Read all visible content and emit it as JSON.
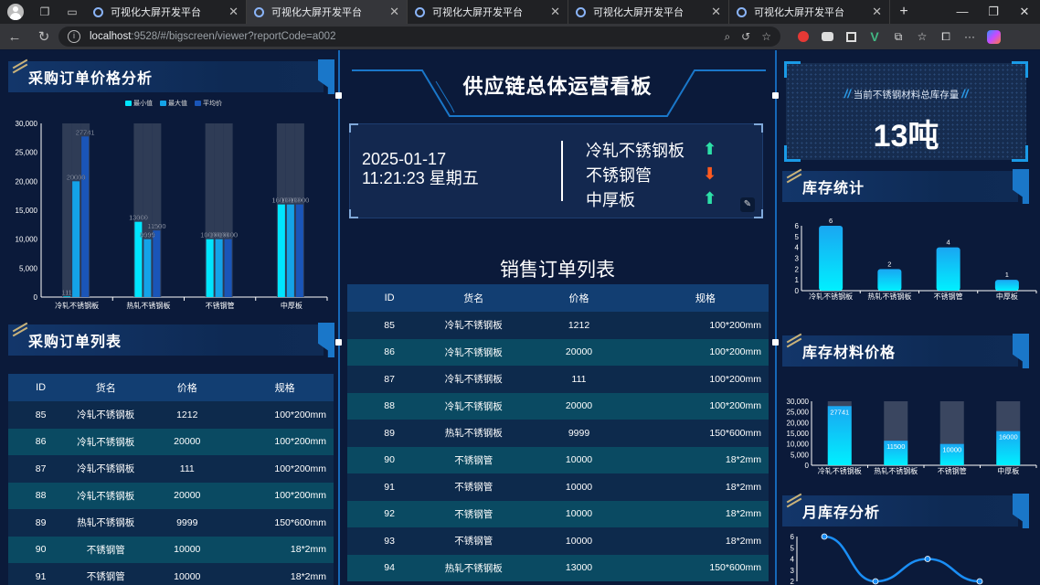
{
  "browser": {
    "tabs": [
      {
        "title": "可视化大屏开发平台",
        "active": false
      },
      {
        "title": "可视化大屏开发平台",
        "active": true
      },
      {
        "title": "可视化大屏开发平台",
        "active": false
      },
      {
        "title": "可视化大屏开发平台",
        "active": false
      },
      {
        "title": "可视化大屏开发平台",
        "active": false
      }
    ],
    "url_host": "localhost",
    "url_path": ":9528/#/bigscreen/viewer?reportCode=a002"
  },
  "left": {
    "price_panel_title": "采购订单价格分析",
    "legend": [
      "最小值",
      "最大值",
      "平均价"
    ],
    "list_panel_title": "采购订单列表",
    "table_headers": [
      "ID",
      "货名",
      "价格",
      "规格"
    ],
    "rows": [
      [
        "85",
        "冷轧不锈钢板",
        "1212",
        "100*200mm"
      ],
      [
        "86",
        "冷轧不锈钢板",
        "20000",
        "100*200mm"
      ],
      [
        "87",
        "冷轧不锈钢板",
        "111",
        "100*200mm"
      ],
      [
        "88",
        "冷轧不锈钢板",
        "20000",
        "100*200mm"
      ],
      [
        "89",
        "热轧不锈钢板",
        "9999",
        "150*600mm"
      ],
      [
        "90",
        "不锈钢管",
        "10000",
        "18*2mm"
      ],
      [
        "91",
        "不锈钢管",
        "10000",
        "18*2mm"
      ]
    ]
  },
  "center": {
    "title": "供应链总体运营看板",
    "date": "2025-01-17",
    "time_week": "11:21:23 星期五",
    "ticker": [
      {
        "name": "冷轧不锈钢板",
        "trend": "up"
      },
      {
        "name": "不锈钢管",
        "trend": "down"
      },
      {
        "name": "中厚板",
        "trend": "up"
      }
    ],
    "sales_title": "销售订单列表",
    "table_headers": [
      "ID",
      "货名",
      "价格",
      "规格"
    ],
    "rows": [
      [
        "85",
        "冷轧不锈钢板",
        "1212",
        "100*200mm"
      ],
      [
        "86",
        "冷轧不锈钢板",
        "20000",
        "100*200mm"
      ],
      [
        "87",
        "冷轧不锈钢板",
        "111",
        "100*200mm"
      ],
      [
        "88",
        "冷轧不锈钢板",
        "20000",
        "100*200mm"
      ],
      [
        "89",
        "热轧不锈钢板",
        "9999",
        "150*600mm"
      ],
      [
        "90",
        "不锈钢管",
        "10000",
        "18*2mm"
      ],
      [
        "91",
        "不锈钢管",
        "10000",
        "18*2mm"
      ],
      [
        "92",
        "不锈钢管",
        "10000",
        "18*2mm"
      ],
      [
        "93",
        "不锈钢管",
        "10000",
        "18*2mm"
      ],
      [
        "94",
        "热轧不锈钢板",
        "13000",
        "150*600mm"
      ]
    ]
  },
  "right": {
    "stock_label": "当前不锈钢材料总库存量",
    "stock_value": "13吨",
    "stock_panel_title": "库存统计",
    "price_panel_title": "库存材料价格",
    "month_panel_title": "月库存分析"
  },
  "colors": {
    "accent": "#1a77c9",
    "cyan": "#00e5ff",
    "up": "#2de0a8",
    "down": "#ff5a1f"
  },
  "chart_data": [
    {
      "type": "bar",
      "id": "purchase-price",
      "categories": [
        "冷轧不锈钢板",
        "热轧不锈钢板",
        "不锈钢管",
        "中厚板"
      ],
      "series": [
        {
          "name": "最小值",
          "values": [
            111,
            13000,
            10000,
            16000
          ]
        },
        {
          "name": "最大值",
          "values": [
            20000,
            9999,
            10000,
            16000
          ]
        },
        {
          "name": "平均价",
          "values": [
            27741,
            11500,
            10000,
            16000
          ]
        }
      ],
      "bar_labels": [
        [
          "111",
          "20000",
          "27741"
        ],
        [
          "13000",
          "9999",
          "11500"
        ],
        [
          "10000",
          "10000",
          "10000"
        ],
        [
          "16000",
          "16000",
          "16000"
        ]
      ],
      "y_ticks": [
        "0",
        "5,000",
        "10,000",
        "15,000",
        "20,000",
        "25,000",
        "30,000"
      ],
      "ylim": [
        0,
        30000
      ]
    },
    {
      "type": "bar",
      "id": "stock-stat",
      "categories": [
        "冷轧不锈钢板",
        "热轧不锈钢板",
        "不锈钢管",
        "中厚板"
      ],
      "values": [
        6,
        2,
        4,
        1
      ],
      "y_ticks": [
        "0",
        "1",
        "2",
        "3",
        "4",
        "5",
        "6"
      ],
      "ylim": [
        0,
        6
      ]
    },
    {
      "type": "bar",
      "id": "stock-price",
      "categories": [
        "冷轧不锈钢板",
        "热轧不锈钢板",
        "不锈钢管",
        "中厚板"
      ],
      "values": [
        27741,
        11500,
        10000,
        16000
      ],
      "y_ticks": [
        "0",
        "5,000",
        "10,000",
        "15,000",
        "20,000",
        "25,000",
        "30,000"
      ],
      "ylim": [
        0,
        30000
      ]
    },
    {
      "type": "line",
      "id": "month-stock",
      "values": [
        6,
        2,
        4,
        2
      ],
      "y_ticks": [
        "2",
        "3",
        "4",
        "5",
        "6"
      ],
      "ylim": [
        2,
        6
      ]
    }
  ]
}
